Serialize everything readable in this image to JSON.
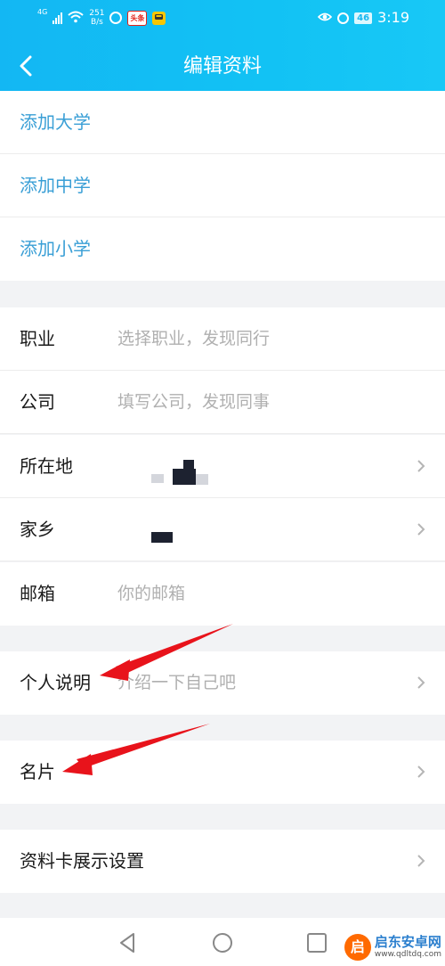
{
  "status_bar": {
    "network_label": "4G",
    "speed_value": "251",
    "speed_unit": "B/s",
    "app_badge_1": "头条",
    "battery": "46",
    "time": "3:19"
  },
  "header": {
    "title": "编辑资料"
  },
  "schools": [
    {
      "label": "添加大学"
    },
    {
      "label": "添加中学"
    },
    {
      "label": "添加小学"
    }
  ],
  "fields": {
    "occupation": {
      "label": "职业",
      "placeholder": "选择职业，发现同行"
    },
    "company": {
      "label": "公司",
      "placeholder": "填写公司，发现同事"
    },
    "location": {
      "label": "所在地"
    },
    "hometown": {
      "label": "家乡"
    },
    "email": {
      "label": "邮箱",
      "placeholder": "你的邮箱"
    }
  },
  "bio": {
    "label": "个人说明",
    "placeholder": "介绍一下自己吧"
  },
  "card": {
    "label": "名片"
  },
  "profile_card_settings": {
    "label": "资料卡展示设置"
  },
  "watermark": {
    "logo": "启",
    "name": "启东安卓网",
    "url": "www.qdltdq.com"
  },
  "colors": {
    "header_bg": "#13b7f3",
    "link_blue": "#3a9fd6",
    "arrow_red": "#e8131b",
    "page_bg": "#f2f3f5"
  }
}
